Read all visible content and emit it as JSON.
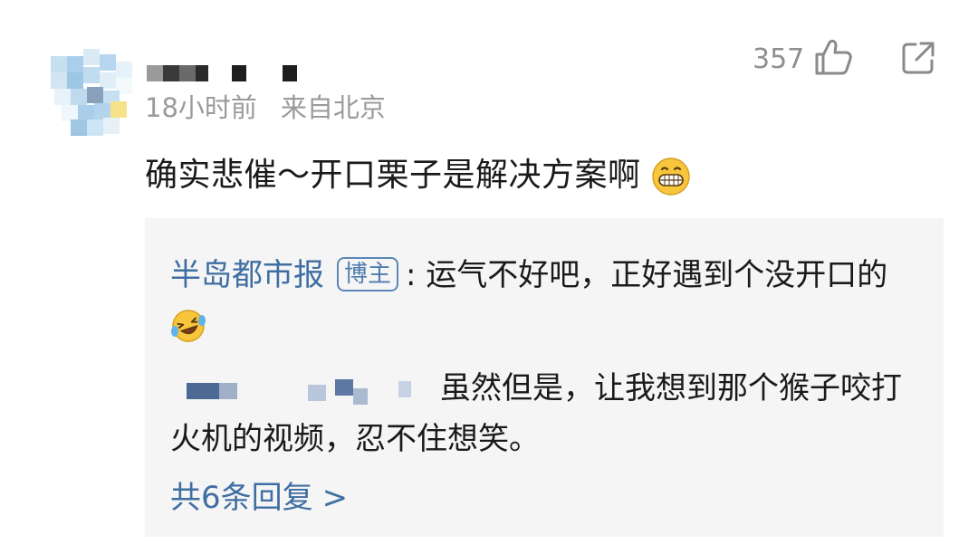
{
  "comment": {
    "like_count": "357",
    "time": "18小时前",
    "location": "来自北京",
    "text": "确实悲催～开口栗子是解决方案啊",
    "emoji": "grinning-face"
  },
  "replies": [
    {
      "author": "半岛都市报",
      "badge": "博主",
      "separator": ":",
      "text": "运气不好吧，正好遇到个没开口的",
      "emoji": "laughing-crying-face"
    },
    {
      "text": "虽然但是，让我想到那个猴子咬打火机的视频，忍不住想笑。"
    }
  ],
  "more_replies": {
    "label": "共6条回复",
    "chevron": ">"
  },
  "icons": {
    "like": "thumbs-up-icon",
    "share": "share-icon"
  },
  "colors": {
    "link_blue": "#3f6ea3",
    "meta_gray": "#9a9a9a",
    "reply_bg": "#f5f5f5"
  }
}
